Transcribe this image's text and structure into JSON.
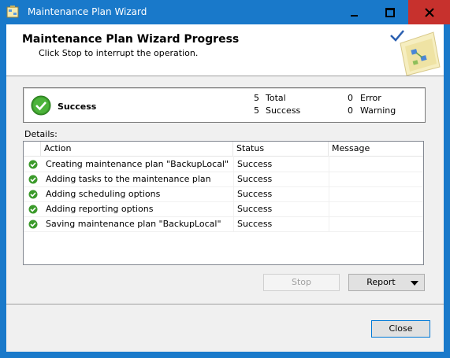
{
  "window": {
    "title": "Maintenance Plan Wizard",
    "controls": {
      "minimize": "minimize",
      "maximize": "maximize",
      "close": "close"
    }
  },
  "header": {
    "title": "Maintenance Plan Wizard Progress",
    "subtitle": "Click Stop to interrupt the operation."
  },
  "summary": {
    "status": "Success",
    "total_count": "5",
    "total_label": "Total",
    "success_count": "5",
    "success_label": "Success",
    "error_count": "0",
    "error_label": "Error",
    "warning_count": "0",
    "warning_label": "Warning"
  },
  "details": {
    "label": "Details:",
    "columns": {
      "action": "Action",
      "status": "Status",
      "message": "Message"
    },
    "rows": [
      {
        "action": "Creating maintenance plan \"BackupLocal\"",
        "status": "Success",
        "message": ""
      },
      {
        "action": "Adding tasks to the maintenance plan",
        "status": "Success",
        "message": ""
      },
      {
        "action": "Adding scheduling options",
        "status": "Success",
        "message": ""
      },
      {
        "action": "Adding reporting options",
        "status": "Success",
        "message": ""
      },
      {
        "action": "Saving maintenance plan \"BackupLocal\"",
        "status": "Success",
        "message": ""
      }
    ]
  },
  "buttons": {
    "stop": "Stop",
    "report": "Report",
    "close": "Close"
  },
  "colors": {
    "titlebar": "#1979ca",
    "close_button": "#c7312d",
    "success_green": "#3a9a2a"
  }
}
